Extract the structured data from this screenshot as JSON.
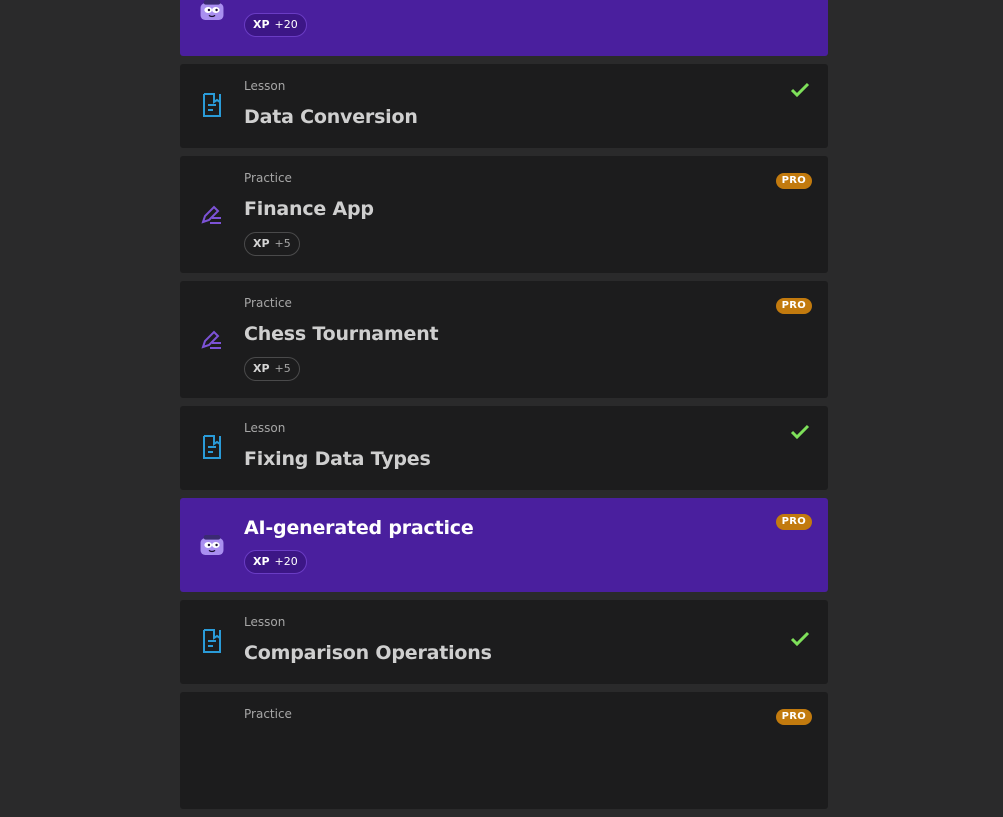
{
  "colors": {
    "background": "#2a2a2b",
    "card": "#1c1c1d",
    "ai_card": "#4a1f9e",
    "pro_badge": "#c27a0e",
    "check": "#7ee05a",
    "lesson_icon": "#2a9bd8",
    "practice_icon": "#7c52d6"
  },
  "items": [
    {
      "kind": "ai",
      "title": "",
      "xp_label": "XP",
      "xp_value": "+20",
      "icon": "ai-mascot-icon"
    },
    {
      "kind": "lesson",
      "type_label": "Lesson",
      "title": "Data Conversion",
      "status": "completed",
      "icon": "lesson-document-icon"
    },
    {
      "kind": "practice",
      "type_label": "Practice",
      "title": "Finance App",
      "xp_label": "XP",
      "xp_value": "+5",
      "badge": "PRO",
      "icon": "practice-pencil-icon"
    },
    {
      "kind": "practice",
      "type_label": "Practice",
      "title": "Chess Tournament",
      "xp_label": "XP",
      "xp_value": "+5",
      "badge": "PRO",
      "icon": "practice-pencil-icon"
    },
    {
      "kind": "lesson",
      "type_label": "Lesson",
      "title": "Fixing Data Types",
      "status": "completed",
      "icon": "lesson-document-icon"
    },
    {
      "kind": "ai",
      "title": "AI-generated practice",
      "xp_label": "XP",
      "xp_value": "+20",
      "badge": "PRO",
      "icon": "ai-mascot-icon"
    },
    {
      "kind": "lesson",
      "type_label": "Lesson",
      "title": "Comparison Operations",
      "status": "completed",
      "icon": "lesson-document-icon"
    },
    {
      "kind": "practice",
      "type_label": "Practice",
      "title": "",
      "badge": "PRO",
      "icon": "practice-pencil-icon"
    }
  ]
}
